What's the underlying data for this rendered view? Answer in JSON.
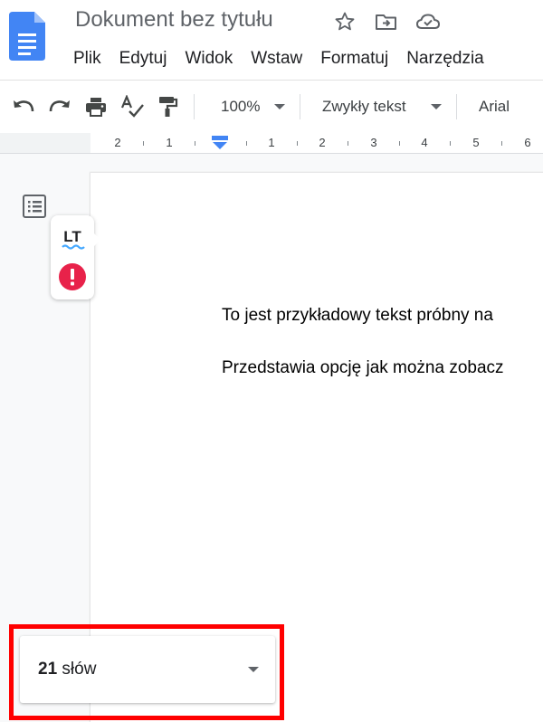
{
  "app": {
    "doc_title": "Dokument bez tytułu",
    "brand_color": "#4285f4"
  },
  "title_icons": [
    "star-icon",
    "move-to-folder-icon",
    "cloud-saved-icon"
  ],
  "menu": [
    {
      "label": "Plik"
    },
    {
      "label": "Edytuj"
    },
    {
      "label": "Widok"
    },
    {
      "label": "Wstaw"
    },
    {
      "label": "Formatuj"
    },
    {
      "label": "Narzędzia"
    }
  ],
  "toolbar": {
    "zoom": "100%",
    "style": "Zwykły tekst",
    "font": "Arial"
  },
  "ruler": {
    "labels": [
      "2",
      "1",
      "1",
      "2",
      "3",
      "4",
      "5",
      "6"
    ]
  },
  "document": {
    "lines": [
      "To jest przykładowy tekst próbny na",
      "Przedstawia opcję jak można zobacz"
    ]
  },
  "language_tool": {
    "logo_text": "LT",
    "error_color": "#e8224a"
  },
  "word_count": {
    "count": "21",
    "unit": "słów",
    "highlight_color": "#ff0000"
  }
}
